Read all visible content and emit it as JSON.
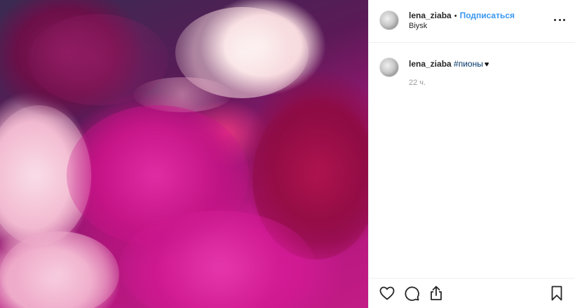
{
  "post": {
    "photo_subject": "peonies-photo",
    "header": {
      "username": "lena_ziaba",
      "separator": "•",
      "follow_label": "Подписаться",
      "location": "Biysk",
      "more_icon": "more-icon"
    },
    "caption": {
      "username": "lena_ziaba",
      "hashtag": "#пионы",
      "emoji": "♥",
      "time": "22 ч."
    },
    "actions": {
      "like_icon": "heart-icon",
      "comment_icon": "comment-icon",
      "share_icon": "share-icon",
      "save_icon": "bookmark-icon"
    },
    "colors": {
      "follow": "#3897f0",
      "hashtag": "#003569",
      "text": "#262626",
      "muted": "#999999",
      "border": "#efefef"
    }
  }
}
